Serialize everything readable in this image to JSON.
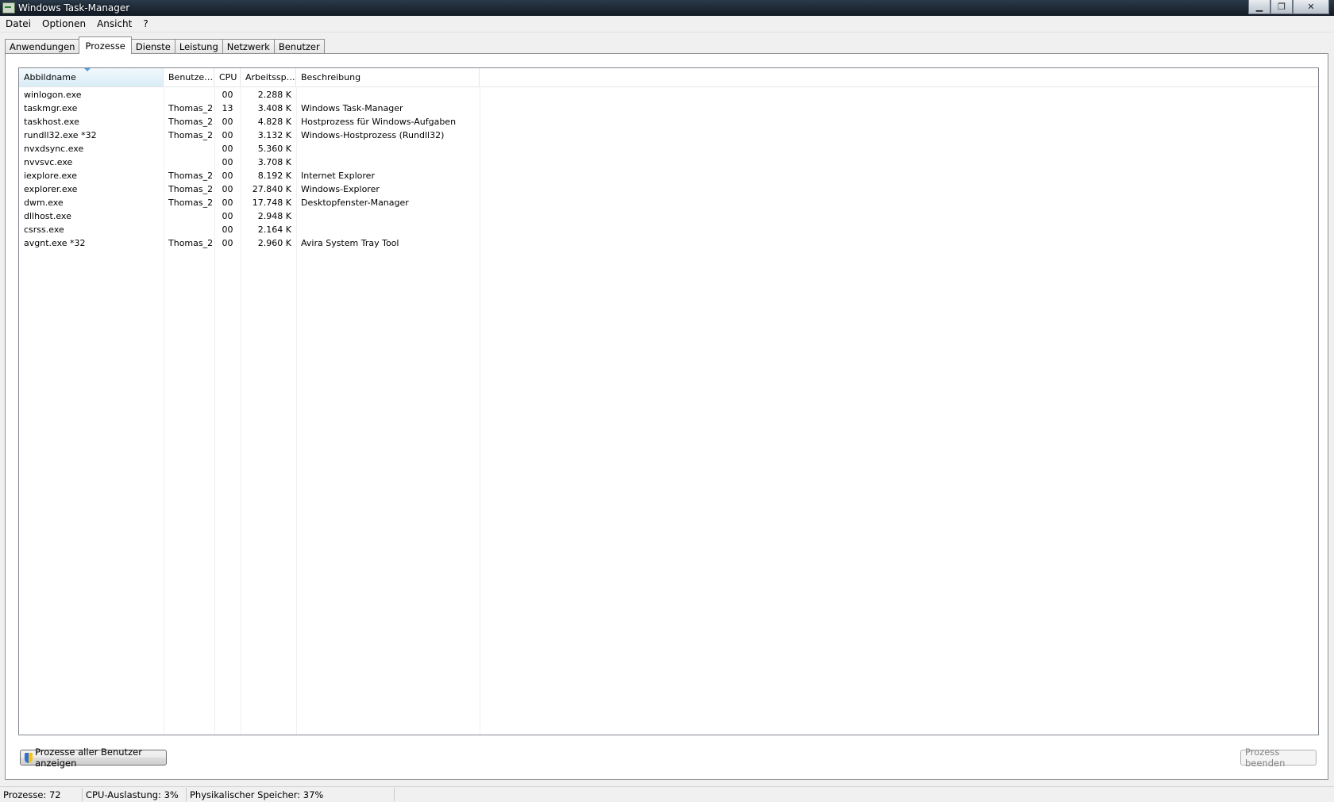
{
  "window": {
    "title": "Windows Task-Manager"
  },
  "menu": [
    "Datei",
    "Optionen",
    "Ansicht",
    "?"
  ],
  "tabs": [
    "Anwendungen",
    "Prozesse",
    "Dienste",
    "Leistung",
    "Netzwerk",
    "Benutzer"
  ],
  "active_tab": "Prozesse",
  "columns": {
    "name": "Abbildname",
    "user": "Benutze…",
    "cpu": "CPU",
    "mem": "Arbeitssp…",
    "desc": "Beschreibung"
  },
  "processes": [
    {
      "name": "winlogon.exe",
      "user": "",
      "cpu": "00",
      "mem": "2.288 K",
      "desc": ""
    },
    {
      "name": "taskmgr.exe",
      "user": "Thomas_2",
      "cpu": "13",
      "mem": "3.408 K",
      "desc": "Windows Task-Manager"
    },
    {
      "name": "taskhost.exe",
      "user": "Thomas_2",
      "cpu": "00",
      "mem": "4.828 K",
      "desc": "Hostprozess für Windows-Aufgaben"
    },
    {
      "name": "rundll32.exe *32",
      "user": "Thomas_2",
      "cpu": "00",
      "mem": "3.132 K",
      "desc": "Windows-Hostprozess (Rundll32)"
    },
    {
      "name": "nvxdsync.exe",
      "user": "",
      "cpu": "00",
      "mem": "5.360 K",
      "desc": ""
    },
    {
      "name": "nvvsvc.exe",
      "user": "",
      "cpu": "00",
      "mem": "3.708 K",
      "desc": ""
    },
    {
      "name": "iexplore.exe",
      "user": "Thomas_2",
      "cpu": "00",
      "mem": "8.192 K",
      "desc": "Internet Explorer"
    },
    {
      "name": "explorer.exe",
      "user": "Thomas_2",
      "cpu": "00",
      "mem": "27.840 K",
      "desc": "Windows-Explorer"
    },
    {
      "name": "dwm.exe",
      "user": "Thomas_2",
      "cpu": "00",
      "mem": "17.748 K",
      "desc": "Desktopfenster-Manager"
    },
    {
      "name": "dllhost.exe",
      "user": "",
      "cpu": "00",
      "mem": "2.948 K",
      "desc": ""
    },
    {
      "name": "csrss.exe",
      "user": "",
      "cpu": "00",
      "mem": "2.164 K",
      "desc": ""
    },
    {
      "name": "avgnt.exe *32",
      "user": "Thomas_2",
      "cpu": "00",
      "mem": "2.960 K",
      "desc": "Avira System Tray Tool"
    }
  ],
  "buttons": {
    "show_all": "Prozesse aller Benutzer anzeigen",
    "end_process": "Prozess beenden"
  },
  "status": {
    "processes": "Prozesse: 72",
    "cpu": "CPU-Auslastung: 3%",
    "memory": "Physikalischer Speicher: 37%"
  }
}
